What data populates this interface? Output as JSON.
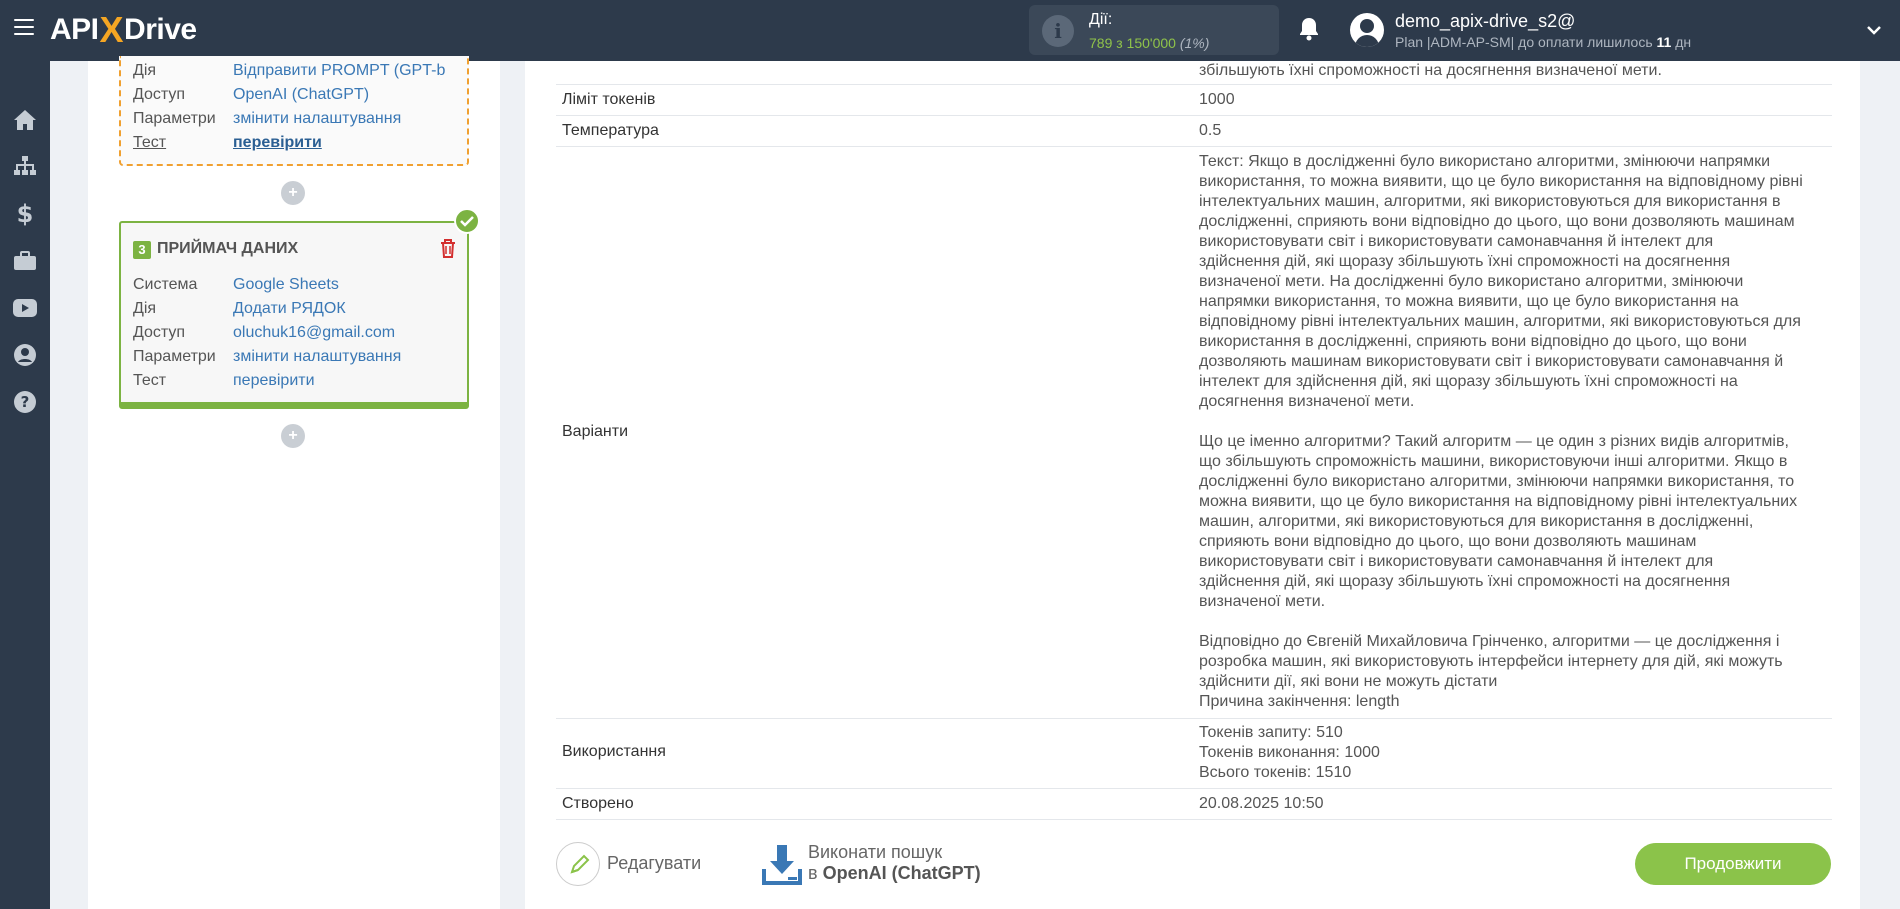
{
  "header": {
    "logo_left": "API",
    "logo_x": "X",
    "logo_right": "Drive",
    "actions_label": "Дії:",
    "actions_count": "789 з 150'000",
    "actions_pct": "(1%)",
    "user_name": "demo_apix-drive_s2@",
    "plan_text": "Plan |ADM-AP-SM| до оплати лишилось",
    "plan_days": "11",
    "plan_unit": "дн"
  },
  "nav": {
    "icons": [
      "home-icon",
      "sitemap-icon",
      "dollar-icon",
      "briefcase-icon",
      "youtube-icon",
      "user-circle-icon",
      "help-icon"
    ]
  },
  "pipeline": {
    "block1": {
      "rows": [
        {
          "k": "Дія",
          "v": "Відправити PROMPT (GPT-ba"
        },
        {
          "k": "Доступ",
          "v": "OpenAI (ChatGPT)"
        },
        {
          "k": "Параметри",
          "v": "змінити налаштування"
        },
        {
          "k": "Тест",
          "v": "перевірити"
        }
      ]
    },
    "block3": {
      "num": "3",
      "title": "ПРИЙМАЧ ДАНИХ",
      "rows": [
        {
          "k": "Система",
          "v": "Google Sheets"
        },
        {
          "k": "Дія",
          "v": "Додати РЯДОК"
        },
        {
          "k": "Доступ",
          "v": "oluchuk16@gmail.com"
        },
        {
          "k": "Параметри",
          "v": "змінити налаштування"
        },
        {
          "k": "Тест",
          "v": "перевірити"
        }
      ]
    },
    "plus": "+"
  },
  "table": {
    "top_fragment": "збільшують їхні спроможності на досягнення визначеної мети.",
    "rows": [
      {
        "label": "Ліміт токенів",
        "value": "1000"
      },
      {
        "label": "Температура",
        "value": "0.5"
      },
      {
        "label": "Варіанти",
        "value": "Текст: Якщо в дослідженні було використано алгоритми, змінюючи напрямки\nвикористання, то можна виявити, що це було використання на відповідному рівні\nінтелектуальних машин, алгоритми, які використовуються для використання в\nдослідженні, сприяють вони відповідно до цього, що вони дозволяють машинам\nвикористовувати світ і використовувати самонавчання й інтелект для\nздійснення дій, які щоразу збільшують їхні спроможності на досягнення\nвизначеної мети. На дослідженні було використано алгоритми, змінюючи\nнапрямки використання, то можна виявити, що це було використання на\nвідповідному рівні інтелектуальних машин, алгоритми, які використовуються для\nвикористання в дослідженні, сприяють вони відповідно до цього, що вони\nдозволяють машинам використовувати світ і використовувати самонавчання й\nінтелект для здійснення дій, які щоразу збільшують їхні спроможності на\nдосягнення визначеної мети.\n\nЩо це іменно алгоритми? Такий алгоритм — це один з різних видів алгоритмів,\nщо збільшують спроможність машини, використовуючи інші алгоритми. Якщо в\nдослідженні було використано алгоритми, змінюючи напрямки використання, то\nможна виявити, що це було використання на відповідному рівні інтелектуальних\nмашин, алгоритми, які використовуються для використання в дослідженні,\nсприяють вони відповідно до цього, що вони дозволяють машинам\nвикористовувати світ і використовувати самонавчання й інтелект для\nздійснення дій, які щоразу збільшують їхні спроможності на досягнення\nвизначеної мети.\n\nВідповідно до Євгеній Михайловича Грінченко, алгоритми — це дослідження і\nрозробка машин, які використовують інтерфейси інтернету для дій, які можуть\nздійснити дії, які вони не можуть дістати\nПричина закінчення: length"
      },
      {
        "label": "Використання",
        "value": "Токенів запиту: 510\nТокенів виконання: 1000\nВсього токенів: 1510"
      },
      {
        "label": "Створено",
        "value": "20.08.2025 10:50"
      }
    ]
  },
  "footer": {
    "edit_label": "Редагувати",
    "search_line1": "Виконати пошук",
    "search_prefix": "в",
    "search_target": "OpenAI (ChatGPT)",
    "continue_label": "Продовжити"
  },
  "colors": {
    "topbar": "#2d3a4b",
    "accent_green": "#8bc34a",
    "link_blue": "#3a78b5",
    "dashed_orange": "#f0a030"
  }
}
